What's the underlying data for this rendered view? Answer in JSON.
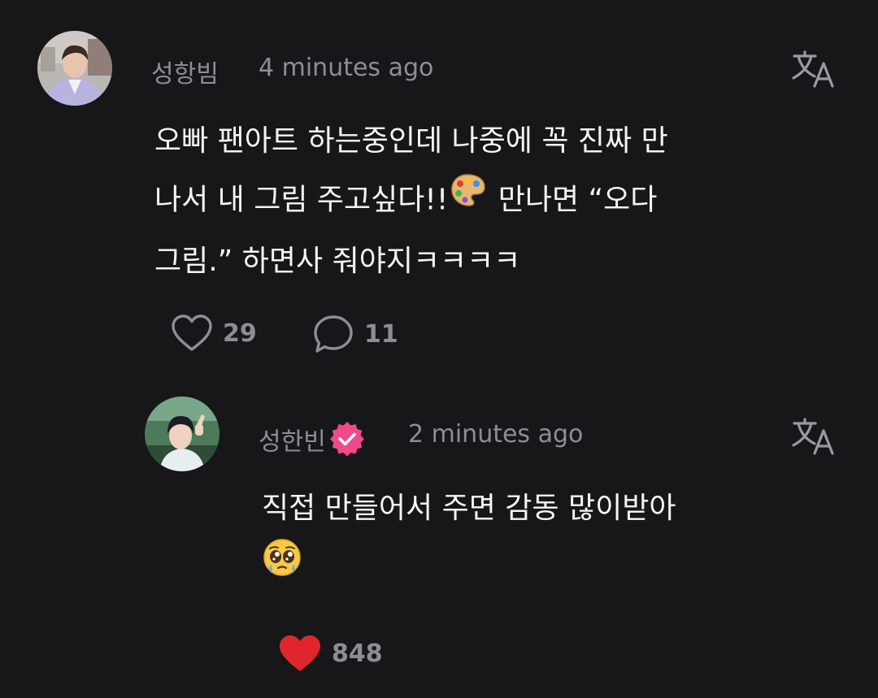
{
  "comment": {
    "author": "성항빔",
    "time": "4 minutes ago",
    "text_lines": [
      "오빠 팬아트 하는중인데 나중에 꼭 진짜 만",
      "나서 내 그림 주고싶다!!",
      " 만나면 “오다",
      "그림.” 하면사 줘야지ㅋㅋㅋㅋ"
    ],
    "inline_emoji": "artist-palette",
    "likes": "29",
    "replies": "11",
    "translate_icon": "translate-icon"
  },
  "reply": {
    "author": "성한빈",
    "verified_badge": "verified-badge",
    "time": "2 minutes ago",
    "text_lines": [
      "직접 만들어서 주면 감동 많이받아"
    ],
    "emoji": "pleading-face",
    "likes": "848",
    "liked": true,
    "translate_icon": "translate-icon"
  },
  "colors": {
    "background": "#17171a",
    "text": "#f4f4f6",
    "muted": "#8e8d97",
    "heart_active": "#e0262c",
    "verified": "#f04a8a"
  }
}
